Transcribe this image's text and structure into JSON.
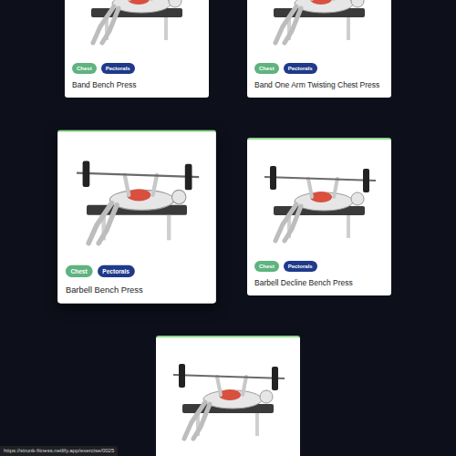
{
  "cards": [
    {
      "title": "Band Bench Press",
      "hovered": false,
      "tags": [
        {
          "label": "Chest",
          "color": "#5fb37f"
        },
        {
          "label": "Pectorals",
          "color": "#1f3a8a"
        }
      ]
    },
    {
      "title": "Band One Arm Twisting Chest Press",
      "hovered": false,
      "tags": [
        {
          "label": "Chest",
          "color": "#5fb37f"
        },
        {
          "label": "Pectorals",
          "color": "#1f3a8a"
        }
      ]
    },
    {
      "title": "Barbell Bench Press",
      "hovered": true,
      "tags": [
        {
          "label": "Chest",
          "color": "#5fb37f"
        },
        {
          "label": "Pectorals",
          "color": "#1f3a8a"
        }
      ]
    },
    {
      "title": "Barbell Decline Bench Press",
      "hovered": false,
      "tags": [
        {
          "label": "Chest",
          "color": "#5fb37f"
        },
        {
          "label": "Pectorals",
          "color": "#1f3a8a"
        }
      ]
    },
    {
      "title": "",
      "hovered": false,
      "tags": []
    }
  ],
  "status_bar": "https://strunk-fitness.netlify.app/exercise/0025"
}
